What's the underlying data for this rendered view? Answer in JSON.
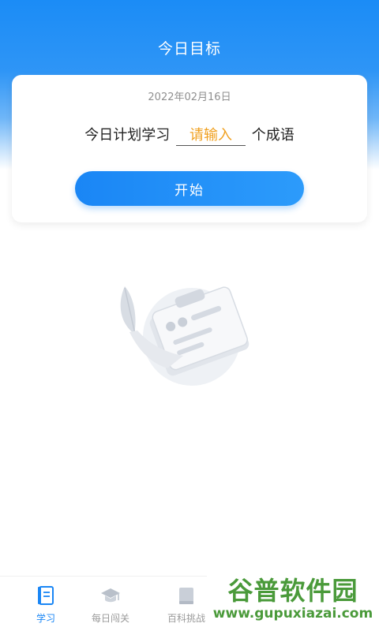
{
  "header": {
    "title": "今日目标"
  },
  "card": {
    "date": "2022年02月16日",
    "plan_prefix": "今日计划学习",
    "plan_placeholder": "请输入",
    "plan_suffix": "个成语",
    "start_label": "开始"
  },
  "tabs": [
    {
      "label": "学习",
      "active": true
    },
    {
      "label": "每日闯关",
      "active": false
    },
    {
      "label": "百科挑战",
      "active": false
    }
  ],
  "watermark": {
    "title": "谷普软件园",
    "url": "www.gupuxiazai.com"
  },
  "colors": {
    "primary": "#1a86f5",
    "accent": "#f0a020",
    "watermark": "#4a9a3a"
  }
}
